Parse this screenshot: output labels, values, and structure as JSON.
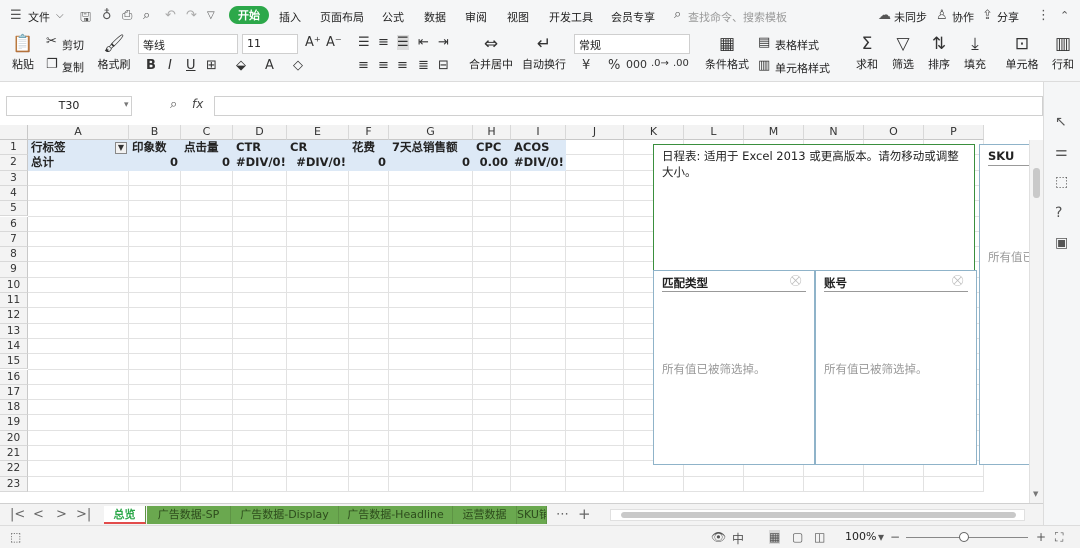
{
  "menubar": {
    "file_label": "文件",
    "tabs": [
      "开始",
      "插入",
      "页面布局",
      "公式",
      "数据",
      "审阅",
      "视图",
      "开发工具",
      "会员专享"
    ],
    "search_placeholder": "查找命令、搜索模板",
    "sync_label": "未同步",
    "collab_label": "协作",
    "share_label": "分享"
  },
  "ribbon": {
    "paste": "粘贴",
    "cut": "剪切",
    "copy": "复制",
    "format_painter": "格式刷",
    "font_name": "等线",
    "font_size": "11",
    "number_format": "常规",
    "merge_center": "合并居中",
    "wrap_text": "自动换行",
    "cond_format": "条件格式",
    "table_style": "表格样式",
    "cell_style": "单元格样式",
    "sum": "求和",
    "filter": "筛选",
    "sort": "排序",
    "fill": "填充",
    "cells": "单元格",
    "rows_cols": "行和"
  },
  "formula_bar": {
    "cell_ref": "T30",
    "fx": "fx",
    "value": ""
  },
  "grid": {
    "columns": [
      "A",
      "B",
      "C",
      "D",
      "E",
      "F",
      "G",
      "H",
      "I",
      "J",
      "K",
      "L",
      "M",
      "N",
      "O",
      "P"
    ],
    "rows": [
      "1",
      "2",
      "3",
      "4",
      "5",
      "6",
      "7",
      "8",
      "9",
      "10",
      "11",
      "12",
      "13",
      "14",
      "15",
      "16",
      "17",
      "18",
      "19",
      "20",
      "21",
      "22",
      "23"
    ],
    "pivot_header": [
      "行标签",
      "印象数",
      "点击量",
      "CTR",
      "CR",
      "花费",
      "7天总销售额",
      "CPC",
      "ACOS"
    ],
    "pivot_total": [
      "总计",
      "0",
      "0",
      "#DIV/0!",
      "#DIV/0!",
      "0",
      "0",
      "0.00",
      "#DIV/0!"
    ]
  },
  "slicers": {
    "timeline_text": "日程表: 适用于 Excel 2013 或更高版本。请勿移动或调整大小。",
    "match_type": {
      "title": "匹配类型",
      "empty": "所有值已被筛选掉。"
    },
    "account": {
      "title": "账号",
      "empty": "所有值已被筛选掉。"
    },
    "sku": {
      "title": "SKU",
      "empty": "所有值已"
    }
  },
  "sheet_tabs": [
    "总览",
    "广告数据-SP",
    "广告数据-Display",
    "广告数据-Headline",
    "运营数据",
    "SKU销"
  ],
  "status": {
    "zoom": "100%"
  },
  "colors": {
    "accent": "#2ca84a",
    "pivot_header_bg": "#dde9f6",
    "tab_green": "#6aa84f"
  }
}
